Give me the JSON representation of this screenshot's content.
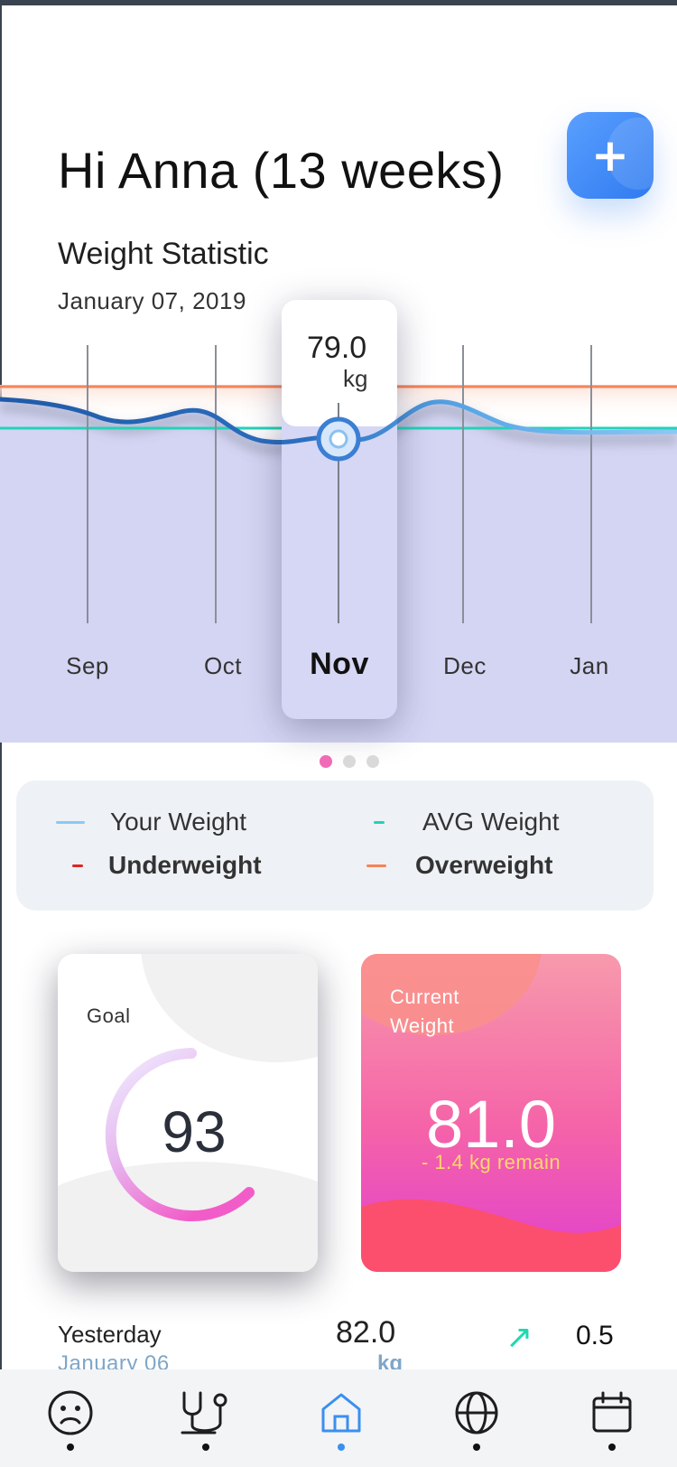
{
  "header": {
    "greeting": "Hi Anna (13 weeks)",
    "add_icon": "plus-icon"
  },
  "statistic": {
    "title": "Weight Statistic",
    "date": "January 07, 2019",
    "months": [
      "Sep",
      "Oct",
      "Nov",
      "Dec",
      "Jan"
    ],
    "selected_month": "Nov",
    "selected_value": "79.0",
    "selected_unit": "kg"
  },
  "pager": {
    "pages": 3,
    "active": 0
  },
  "legend": {
    "your_weight": "Your Weight",
    "avg_weight": "AVG Weight",
    "underweight": "Underweight",
    "overweight": "Overweight",
    "colors": {
      "your_weight": "#8cc8f5",
      "avg_weight": "#22d3b8",
      "underweight": "#e02424",
      "overweight": "#f5845a"
    }
  },
  "goal": {
    "label": "Goal",
    "value": "93"
  },
  "current": {
    "label": "Current Weight",
    "value": "81.0",
    "remain": "- 1.4 kg remain"
  },
  "history": {
    "label": "Yesterday",
    "date": "January 06",
    "value": "82.0",
    "unit": "kg",
    "diff": "0.5",
    "arrow_icon": "arrow-up-right-icon"
  },
  "tabs": [
    {
      "name": "mood",
      "icon": "sad-face-icon"
    },
    {
      "name": "health",
      "icon": "stethoscope-icon"
    },
    {
      "name": "home",
      "icon": "home-icon",
      "active": true
    },
    {
      "name": "world",
      "icon": "globe-icon"
    },
    {
      "name": "calendar",
      "icon": "calendar-icon"
    }
  ]
}
